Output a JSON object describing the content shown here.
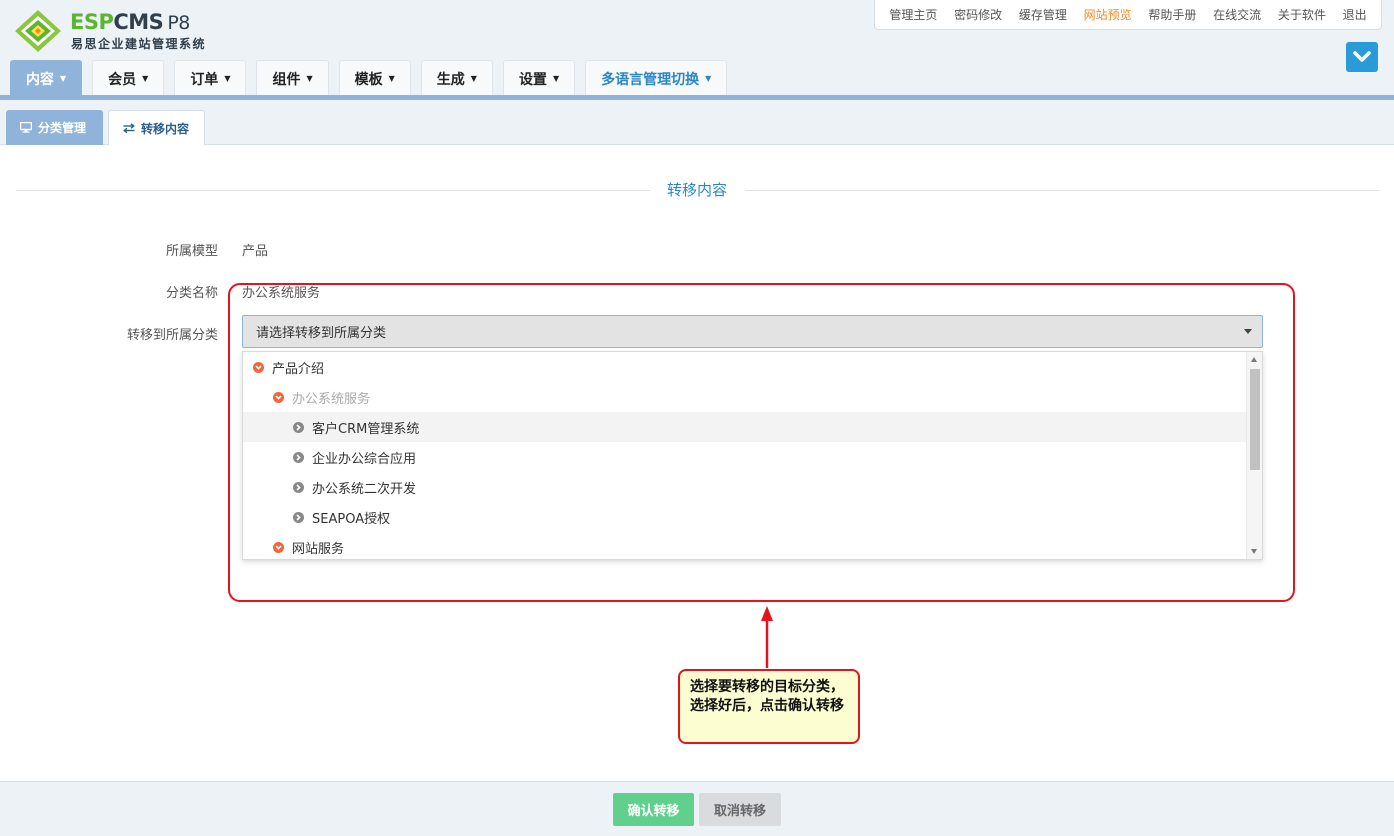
{
  "brand": {
    "word_green": "ESP",
    "word_dark": "CMS",
    "version": "P8",
    "subtitle": "易思企业建站管理系统"
  },
  "top_links": [
    {
      "label": "管理主页",
      "active": false
    },
    {
      "label": "密码修改",
      "active": false
    },
    {
      "label": "缓存管理",
      "active": false
    },
    {
      "label": "网站预览",
      "active": true
    },
    {
      "label": "帮助手册",
      "active": false
    },
    {
      "label": "在线交流",
      "active": false
    },
    {
      "label": "关于软件",
      "active": false
    },
    {
      "label": "退出",
      "active": false
    }
  ],
  "main_nav": [
    {
      "label": "内容",
      "active": true
    },
    {
      "label": "会员",
      "active": false
    },
    {
      "label": "订单",
      "active": false
    },
    {
      "label": "组件",
      "active": false
    },
    {
      "label": "模板",
      "active": false
    },
    {
      "label": "生成",
      "active": false
    },
    {
      "label": "设置",
      "active": false
    },
    {
      "label": "多语言管理切换",
      "active": false
    }
  ],
  "sub_tabs": {
    "category_manage": "分类管理",
    "transfer_content": "转移内容"
  },
  "form": {
    "section_title": "转移内容",
    "model_label": "所属模型",
    "model_value": "产品",
    "category_label": "分类名称",
    "category_value": "办公系统服务",
    "target_label": "转移到所属分类",
    "select_placeholder": "请选择转移到所属分类",
    "options": [
      {
        "label": "产品介绍",
        "expanded": true,
        "disabled": false,
        "hover": false
      },
      {
        "label": "办公系统服务",
        "expanded": true,
        "disabled": true,
        "hover": false
      },
      {
        "label": "客户CRM管理系统",
        "expanded": false,
        "disabled": false,
        "hover": true
      },
      {
        "label": "企业办公综合应用",
        "expanded": false,
        "disabled": false,
        "hover": false
      },
      {
        "label": "办公系统二次开发",
        "expanded": false,
        "disabled": false,
        "hover": false
      },
      {
        "label": "SEAPOA授权",
        "expanded": false,
        "disabled": false,
        "hover": false
      },
      {
        "label": "网站服务",
        "expanded": true,
        "disabled": false,
        "hover": false
      }
    ]
  },
  "annotation": {
    "text": "选择要转移的目标分类，选择好后，点击确认转移",
    "color": "#e3141b"
  },
  "footer": {
    "confirm_label": "确认转移",
    "cancel_label": "取消转移"
  },
  "colors": {
    "accent": "#2a86c9",
    "nav_active": "#8fb3d9",
    "highlight_link": "#f08a24",
    "confirm_button": "#62d08d"
  }
}
